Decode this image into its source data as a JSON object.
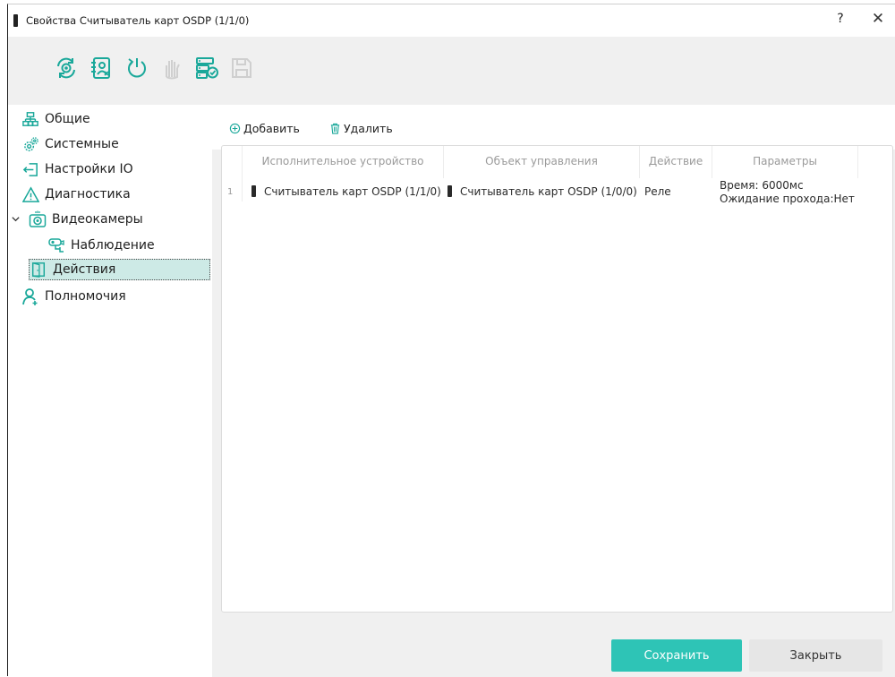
{
  "window": {
    "title": "Свойства Считыватель карт OSDP (1/1/0)",
    "help_label": "?",
    "close_label": "✕"
  },
  "toolbar": {
    "items": [
      {
        "name": "sync-icon",
        "disabled": false
      },
      {
        "name": "person-card-icon",
        "disabled": false
      },
      {
        "name": "power-cycle-icon",
        "disabled": false
      },
      {
        "name": "hand-block-icon",
        "disabled": true
      },
      {
        "name": "server-check-icon",
        "disabled": false
      },
      {
        "name": "save-disk-icon",
        "disabled": true
      }
    ]
  },
  "tree": {
    "items": [
      {
        "label": "Общие",
        "icon": "network-icon"
      },
      {
        "label": "Системные",
        "icon": "gears-icon"
      },
      {
        "label": "Настройки IO",
        "icon": "io-arrow-icon"
      },
      {
        "label": "Диагностика",
        "icon": "warning-triangle-icon"
      },
      {
        "label": "Видеокамеры",
        "icon": "camera-icon",
        "expanded": true
      },
      {
        "label": "Наблюдение",
        "icon": "cctv-icon"
      },
      {
        "label": "Действия",
        "icon": "door-icon",
        "selected": true
      },
      {
        "label": "Полномочия",
        "icon": "user-add-icon"
      }
    ]
  },
  "actions": {
    "add_label": "Добавить",
    "delete_label": "Удалить"
  },
  "table": {
    "headers": [
      "Исполнительное устройство",
      "Объект управления",
      "Действие",
      "Параметры"
    ],
    "rows": [
      {
        "num": "1",
        "device": "Считыватель карт OSDP (1/1/0)",
        "object": "Считыватель карт OSDP (1/0/0)",
        "action": "Реле",
        "params_line1": "Время: 6000мс",
        "params_line2": "Ожидание прохода:Нет"
      }
    ]
  },
  "footer": {
    "save_label": "Сохранить",
    "close_label": "Закрыть"
  },
  "colors": {
    "accent": "#2ec4b6",
    "selection": "#cdeae6",
    "icon_teal": "#1aa89a"
  }
}
